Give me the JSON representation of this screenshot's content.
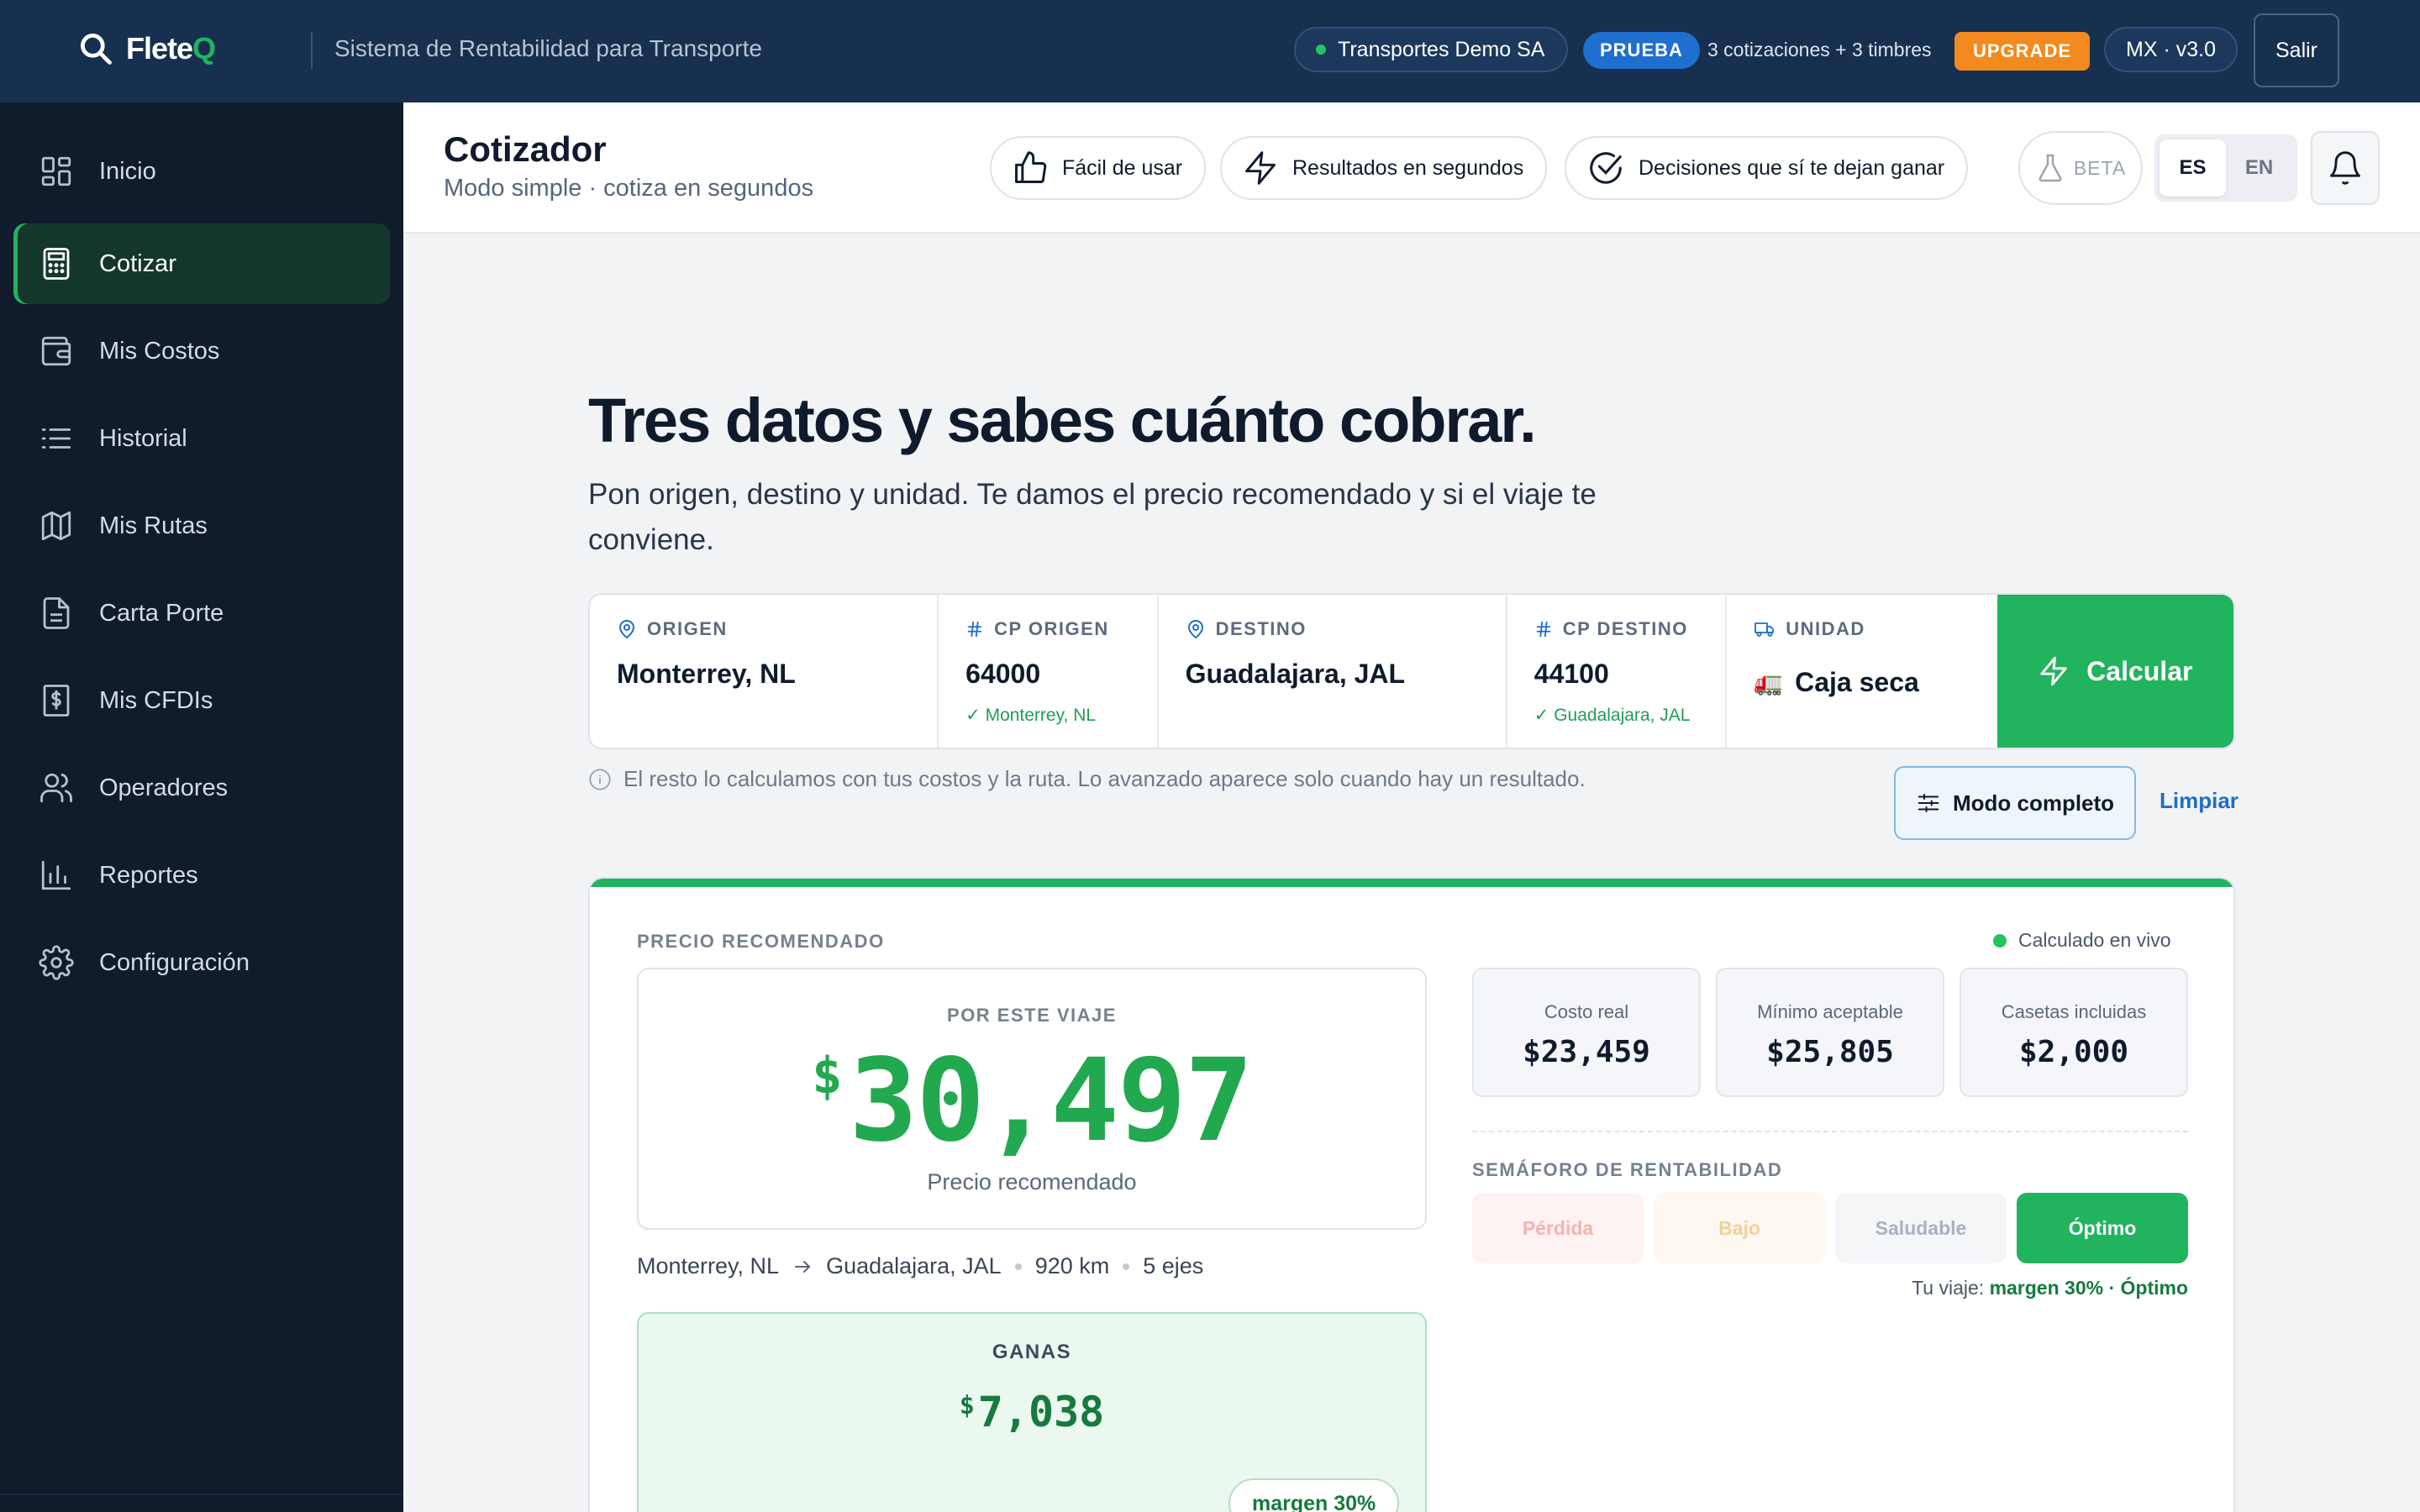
{
  "topbar": {
    "brand": "FleteQ",
    "brand_main": "Flete",
    "brand_accent": "Q",
    "tagline": "Sistema de Rentabilidad para Transporte",
    "company": "Transportes Demo SA",
    "plan_badge": "PRUEBA",
    "credits": "3 cotizaciones + 3 timbres",
    "upgrade": "UPGRADE",
    "version": "MX · v3.0",
    "logout": "Salir"
  },
  "sidebar": {
    "items": [
      {
        "label": "Inicio",
        "icon": "grid-icon"
      },
      {
        "label": "Cotizar",
        "icon": "calculator-icon",
        "active": true
      },
      {
        "label": "Mis Costos",
        "icon": "wallet-icon"
      },
      {
        "label": "Historial",
        "icon": "list-icon"
      },
      {
        "label": "Mis Rutas",
        "icon": "map-icon"
      },
      {
        "label": "Carta Porte",
        "icon": "document-icon"
      },
      {
        "label": "Mis CFDIs",
        "icon": "invoice-icon"
      },
      {
        "label": "Operadores",
        "icon": "users-icon"
      },
      {
        "label": "Reportes",
        "icon": "bar-chart-icon"
      },
      {
        "label": "Configuración",
        "icon": "gear-icon"
      }
    ]
  },
  "header": {
    "title": "Cotizador",
    "subtitle": "Modo simple · cotiza en segundos",
    "pills": [
      "Fácil de usar",
      "Resultados en segundos",
      "Decisiones que sí te dejan ganar"
    ],
    "beta": "BETA",
    "lang_es": "ES",
    "lang_en": "EN"
  },
  "hero": {
    "title": "Tres datos y sabes cuánto cobrar.",
    "subtitle": "Pon origen, destino y unidad. Te damos el precio recomendado y si el viaje te conviene."
  },
  "form": {
    "origen_label": "ORIGEN",
    "origen_value": "Monterrey, NL",
    "cp_origen_label": "CP ORIGEN",
    "cp_origen_value": "64000",
    "cp_origen_check": "✓ Monterrey, NL",
    "destino_label": "DESTINO",
    "destino_value": "Guadalajara, JAL",
    "cp_destino_label": "CP DESTINO",
    "cp_destino_value": "44100",
    "cp_destino_check": "✓ Guadalajara, JAL",
    "unidad_label": "UNIDAD",
    "unidad_value": "Caja seca",
    "unidad_emoji": "🚛",
    "calcular": "Calcular",
    "hint": "El resto lo calculamos con tus costos y la ruta. Lo avanzado aparece solo cuando hay un resultado.",
    "modo_completo": "Modo completo",
    "limpiar": "Limpiar"
  },
  "result": {
    "section_label": "PRECIO RECOMENDADO",
    "live": "Calculado en vivo",
    "box_label": "POR ESTE VIAJE",
    "currency": "$",
    "price": "30,497",
    "price_caption": "Precio recomendado",
    "route_origin": "Monterrey, NL",
    "route_dest": "Guadalajara, JAL",
    "distance": "920 km",
    "axles": "5 ejes",
    "ganas_label": "GANAS",
    "ganas_value": "7,038",
    "margen_pill": "margen 30%",
    "stats": [
      {
        "label": "Costo real",
        "value": "$23,459"
      },
      {
        "label": "Mínimo aceptable",
        "value": "$25,805"
      },
      {
        "label": "Casetas incluidas",
        "value": "$2,000"
      }
    ],
    "semaforo_label": "SEMÁFORO DE RENTABILIDAD",
    "semaforo": [
      {
        "label": "Pérdida",
        "color": "#f5b3ad",
        "bg": "#fdf3f2"
      },
      {
        "label": "Bajo",
        "color": "#f3cf99",
        "bg": "#fdf8f0"
      },
      {
        "label": "Saludable",
        "color": "#a8b2bf",
        "bg": "#f4f6f8"
      },
      {
        "label": "Óptimo",
        "color": "#ffffff",
        "bg": "#22b35e",
        "selected": true
      }
    ],
    "tu_viaje_prefix": "Tu viaje:",
    "tu_viaje_value": "margen 30% · Óptimo"
  },
  "colors": {
    "accent": "#22b35e",
    "topbar": "#173050",
    "sidebar": "#101c2c",
    "upgrade": "#f28a1f",
    "badge_blue": "#1f6fd1",
    "link": "#1b6fc9"
  }
}
